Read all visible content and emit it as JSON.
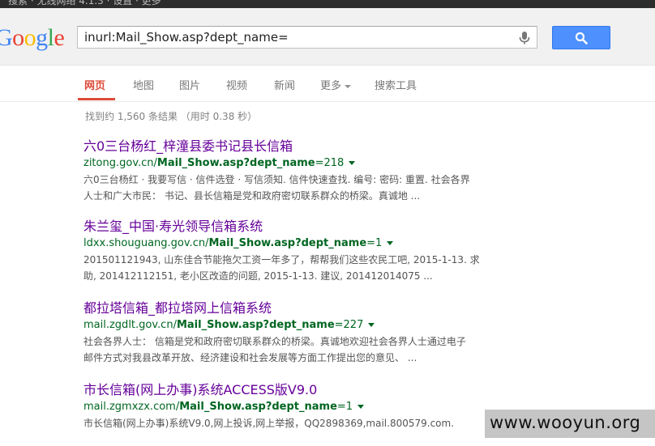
{
  "topbar": {
    "text": "搜索 · 无线网络 4.1.3 · 设置 · 更多"
  },
  "logo": {
    "letters": [
      "G",
      "o",
      "o",
      "g",
      "l",
      "e"
    ],
    "colors": [
      "#4285f4",
      "#ea4335",
      "#fbbc05",
      "#4285f4",
      "#34a853",
      "#ea4335"
    ]
  },
  "search": {
    "query": "inurl:Mail_Show.asp?dept_name="
  },
  "icons": {
    "mic": "microphone-icon",
    "search": "search-icon"
  },
  "tabs": [
    {
      "label": "网页",
      "active": true
    },
    {
      "label": "地图"
    },
    {
      "label": "图片"
    },
    {
      "label": "视频"
    },
    {
      "label": "新闻"
    },
    {
      "label": "更多"
    },
    {
      "label": "搜索工具"
    }
  ],
  "stats": "找到约 1,560 条结果 （用时 0.38 秒）",
  "results": [
    {
      "title": "六0三台杨红_梓潼县委书记县长信箱",
      "url_domain": "zitong.gov.cn/",
      "url_bold": "Mail_Show.asp?dept_name",
      "url_tail": "=218",
      "snippet_1": "六0三台杨红 · 我要写信 · 信件选登 · 写信须知. 信件快速查找. 编号: 密码: 重置. 社会各界",
      "snippet_2": "人士和广大市民： 书记、县长信箱是党和政府密切联系群众的桥梁。真诚地 ..."
    },
    {
      "title": "朱兰玺_中国·寿光领导信箱系统",
      "url_domain": "ldxx.shouguang.gov.cn/",
      "url_bold": "Mail_Show.asp?dept_name",
      "url_tail": "=1",
      "snippet_1": "201501121943, 山东佳合节能拖欠工资一年多了，帮帮我们这些农民工吧, 2015-1-13. 求",
      "snippet_2": "助, 201412112151, 老小区改造的问题, 2015-1-13. 建议, 201412014075 ..."
    },
    {
      "title": "都拉塔信箱_都拉塔网上信箱系统",
      "url_domain": "mail.zgdlt.gov.cn/",
      "url_bold": "Mail_Show.asp?dept_name",
      "url_tail": "=227",
      "snippet_1": "社会各界人士： 信箱是党和政府密切联系群众的桥梁。真诚地欢迎社会各界人士通过电子",
      "snippet_2": "邮件方式对我县改革开放、经济建设和社会发展等方面工作提出您的意见、 ..."
    },
    {
      "title": "市长信箱(网上办事)系统ACCESS版V9.0",
      "url_domain": "mail.zgmxzx.com/",
      "url_bold": "Mail_Show.asp?dept_name",
      "url_tail": "=1",
      "snippet_1": "市长信箱(网上办事)系统V9.0,网上投诉,网上举报，QQ2898369,mail.800579.com.",
      "snippet_2": ""
    }
  ],
  "watermark": "www.wooyun.org"
}
